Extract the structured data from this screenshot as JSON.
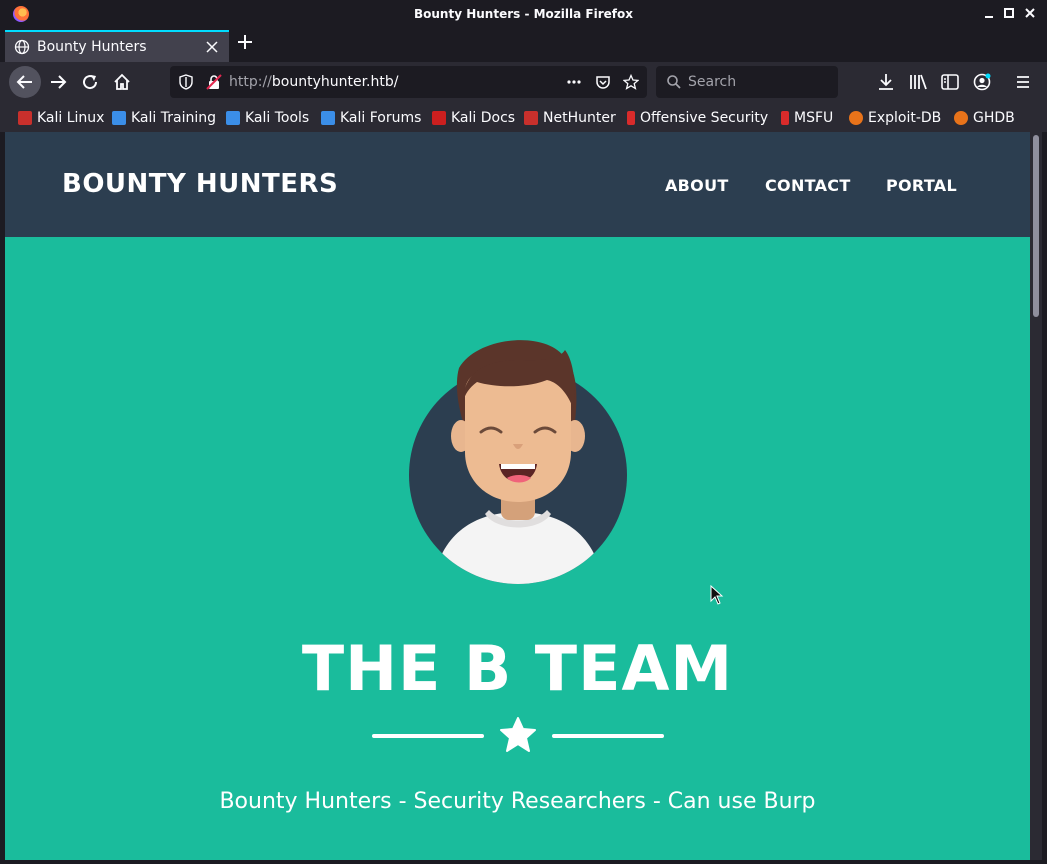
{
  "window": {
    "title": "Bounty Hunters - Mozilla Firefox"
  },
  "tabs": [
    {
      "label": "Bounty Hunters"
    }
  ],
  "urlbar": {
    "protocol": "http://",
    "host": "bountyhunter.htb/"
  },
  "search": {
    "placeholder": "Search"
  },
  "bookmarks": [
    {
      "label": "Kali Linux",
      "icon": "kali-icon",
      "color": "#c9302c"
    },
    {
      "label": "Kali Training",
      "icon": "kali-training-icon",
      "color": "#3b8ee8"
    },
    {
      "label": "Kali Tools",
      "icon": "kali-tools-icon",
      "color": "#3b8ee8"
    },
    {
      "label": "Kali Forums",
      "icon": "kali-forums-icon",
      "color": "#3b8ee8"
    },
    {
      "label": "Kali Docs",
      "icon": "kali-docs-icon",
      "color": "#cc1f1f"
    },
    {
      "label": "NetHunter",
      "icon": "nethunter-icon",
      "color": "#c9302c"
    },
    {
      "label": "Offensive Security",
      "icon": "offsec-icon",
      "color": "#d92b2b"
    },
    {
      "label": "MSFU",
      "icon": "msfu-icon",
      "color": "#d92b2b"
    },
    {
      "label": "Exploit-DB",
      "icon": "exploitdb-icon",
      "color": "#e8731a"
    },
    {
      "label": "GHDB",
      "icon": "ghdb-icon",
      "color": "#e8731a"
    }
  ],
  "site": {
    "brand": "BOUNTY HUNTERS",
    "nav": [
      "ABOUT",
      "CONTACT",
      "PORTAL"
    ],
    "headline": "THE B TEAM",
    "subtitle": "Bounty Hunters - Security Researchers - Can use Burp",
    "colors": {
      "nav_bg": "#2c3e50",
      "masthead_bg": "#1abc9c"
    }
  }
}
